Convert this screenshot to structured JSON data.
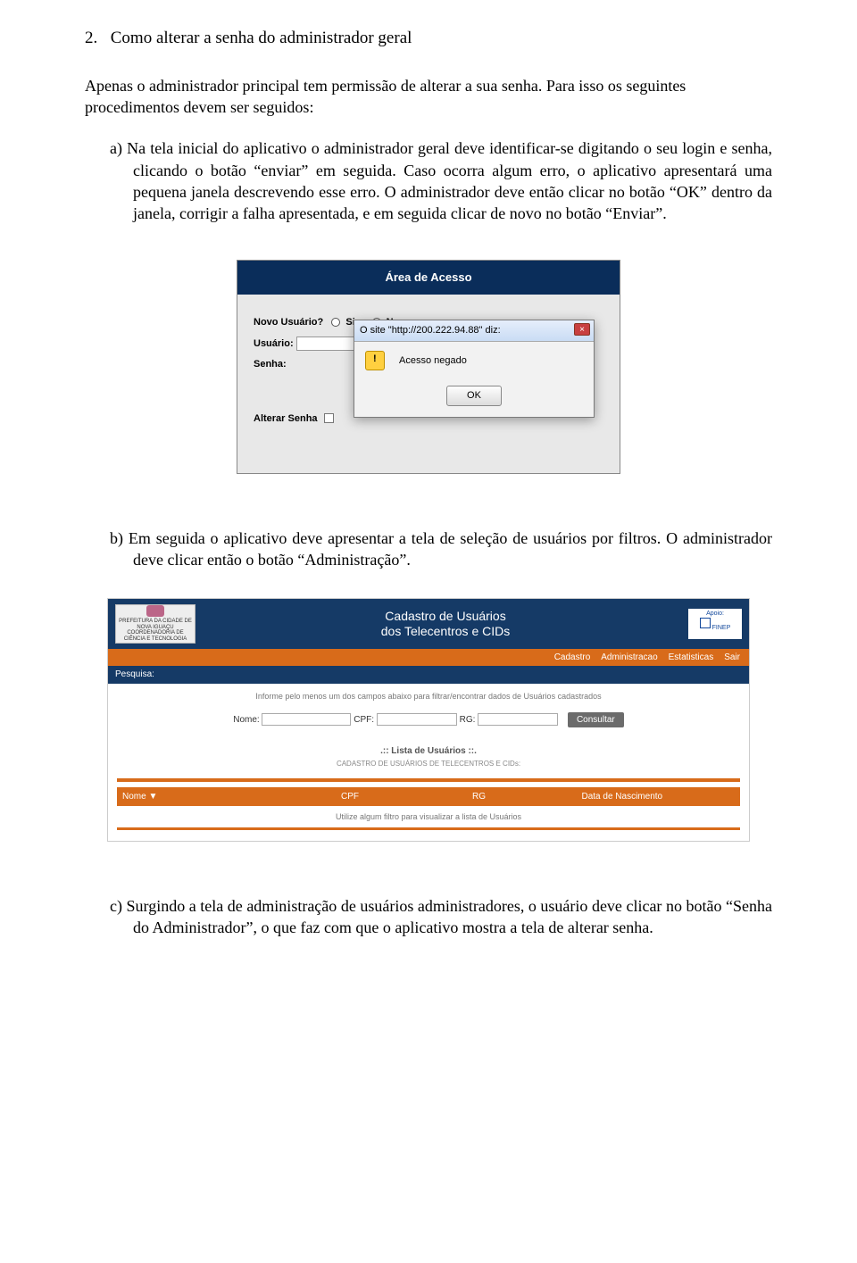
{
  "section": {
    "number": "2.",
    "title": "Como alterar a senha do administrador geral"
  },
  "intro": "Apenas o administrador principal tem permissão de alterar a sua senha. Para isso os seguintes procedimentos devem ser seguidos:",
  "item_a": {
    "letter": "a)",
    "text": "Na tela inicial do aplicativo o administrador geral deve identificar-se digitando o seu login e senha, clicando o botão “enviar” em seguida. Caso ocorra algum erro, o aplicativo apresentará uma pequena janela descrevendo esse erro. O administrador deve então clicar no botão “OK” dentro da janela, corrigir a falha apresentada, e em seguida clicar de novo no botão “Enviar”."
  },
  "item_b": {
    "letter": "b)",
    "text": "Em seguida o aplicativo deve apresentar a tela de seleção de usuários por filtros. O administrador deve clicar então o botão “Administração”."
  },
  "item_c": {
    "letter": "c)",
    "text": "Surgindo a tela de administração de usuários administradores, o usuário deve clicar no botão “Senha do Administrador”, o que faz com que o aplicativo mostra a tela de alterar senha."
  },
  "fig1": {
    "area_title": "Área de Acesso",
    "novo_usuario_label": "Novo Usuário?",
    "sim": "Sim",
    "nao": "Nao",
    "usuario_label": "Usuário:",
    "senha_label": "Senha:",
    "alterar_label": "Alterar Senha",
    "dlg_title": "O site \"http://200.222.94.88\" diz:",
    "dlg_msg": "Acesso negado",
    "dlg_ok": "OK"
  },
  "fig2": {
    "logo_line1": "PREFEITURA DA CIDADE DE NOVA IGUAÇU",
    "logo_line2": "COORDENADORIA DE CIÊNCIA E TECNOLOGIA",
    "banner_l1": "Cadastro de Usuários",
    "banner_l2": "dos Telecentros e CIDs",
    "apoio": "Apoio:",
    "finep": "FINEP",
    "nav": [
      "Cadastro",
      "Administracao",
      "Estatisticas",
      "Sair"
    ],
    "pesquisa": "Pesquisa:",
    "hint": "Informe pelo menos um dos campos abaixo para filtrar/encontrar dados de Usuários cadastrados",
    "nome": "Nome:",
    "cpf": "CPF:",
    "rg": "RG:",
    "consultar": "Consultar",
    "lista_title": ".:: Lista de Usuários ::.",
    "lista_sub": "CADASTRO DE USUÁRIOS DE TELECENTROS E CIDs:",
    "th": [
      "Nome ▼",
      "CPF",
      "RG",
      "Data de Nascimento"
    ],
    "empty": "Utilize algum filtro para visualizar a lista de Usuários"
  }
}
